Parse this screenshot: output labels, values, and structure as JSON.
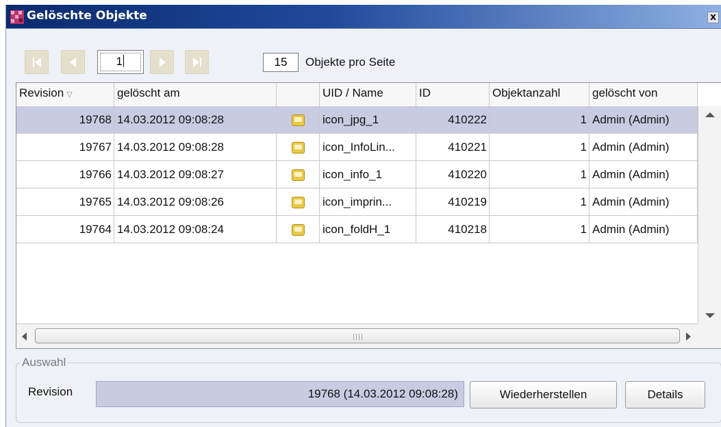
{
  "window": {
    "title": "Gelöschte Objekte",
    "close_label": "x"
  },
  "toolbar": {
    "page": "1",
    "per_page": "15",
    "per_page_label": "Objekte pro Seite"
  },
  "table": {
    "columns": [
      "Revision",
      "gelöscht am",
      "",
      "UID / Name",
      "ID",
      "Objektanzahl",
      "gelöscht von"
    ],
    "rows": [
      {
        "revision": "19768",
        "date": "14.03.2012 09:08:28",
        "icon": "image-icon",
        "name": "icon_jpg_1",
        "id": "410222",
        "count": "1",
        "by": "Admin (Admin)",
        "selected": true
      },
      {
        "revision": "19767",
        "date": "14.03.2012 09:08:28",
        "icon": "image-icon",
        "name": "icon_InfoLin...",
        "id": "410221",
        "count": "1",
        "by": "Admin (Admin)",
        "selected": false
      },
      {
        "revision": "19766",
        "date": "14.03.2012 09:08:27",
        "icon": "image-icon",
        "name": "icon_info_1",
        "id": "410220",
        "count": "1",
        "by": "Admin (Admin)",
        "selected": false
      },
      {
        "revision": "19765",
        "date": "14.03.2012 09:08:26",
        "icon": "image-icon",
        "name": "icon_imprin...",
        "id": "410219",
        "count": "1",
        "by": "Admin (Admin)",
        "selected": false
      },
      {
        "revision": "19764",
        "date": "14.03.2012 09:08:24",
        "icon": "image-icon",
        "name": "icon_foldH_1",
        "id": "410218",
        "count": "1",
        "by": "Admin (Admin)",
        "selected": false
      }
    ]
  },
  "selection": {
    "group_label": "Auswahl",
    "revision_label": "Revision",
    "revision_value": "19768 (14.03.2012 09:08:28)",
    "restore_label": "Wiederherstellen",
    "details_label": "Details"
  }
}
